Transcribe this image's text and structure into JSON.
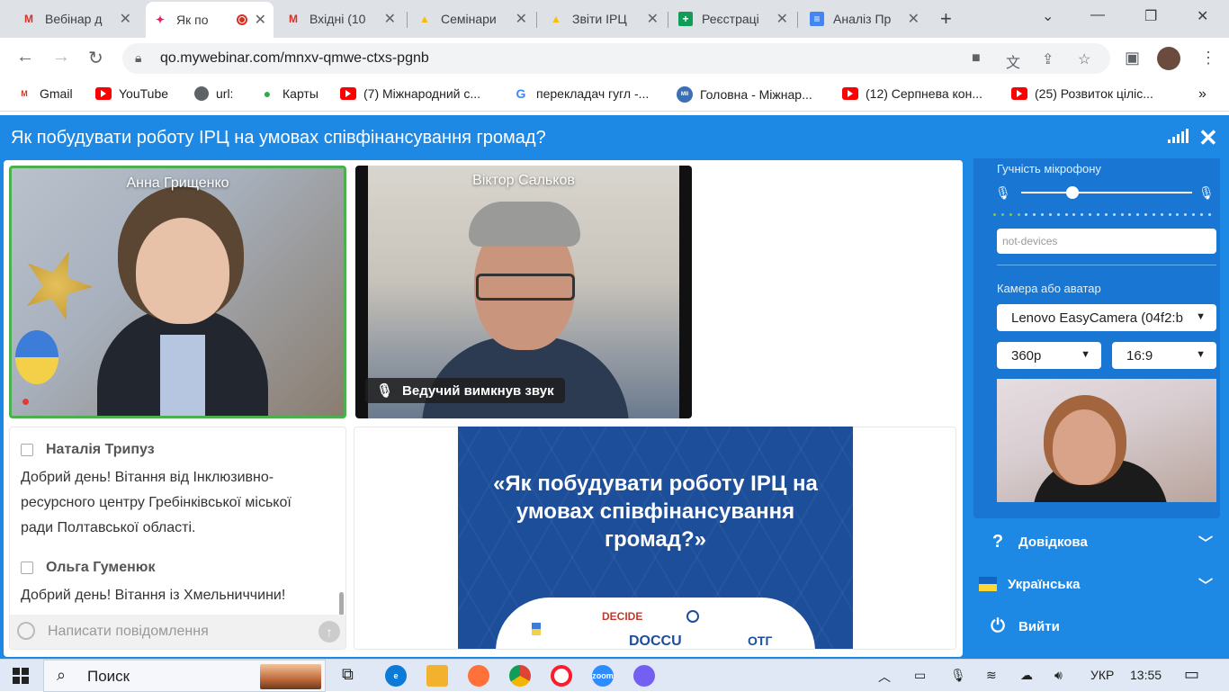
{
  "browser": {
    "tabs": [
      {
        "label": "Вебінар д",
        "icon": "gmail-icon",
        "color": "#d93025"
      },
      {
        "label": "Як по",
        "icon": "mywebinar-icon",
        "color": "#e91e63",
        "recording": true
      },
      {
        "label": "Вхідні (10",
        "icon": "gmail-icon",
        "color": "#d93025"
      },
      {
        "label": "Семінари",
        "icon": "drive-icon",
        "color": "#fbbc04"
      },
      {
        "label": "Звіти ІРЦ",
        "icon": "drive-icon",
        "color": "#fbbc04"
      },
      {
        "label": "Реєстраці",
        "icon": "sheets-plus-icon",
        "color": "#0f9d58"
      },
      {
        "label": "Аналіз Пр",
        "icon": "docs-icon",
        "color": "#4285f4"
      }
    ],
    "url": "qo.mywebinar.com/mnxv-qmwe-ctxs-pgnb",
    "bookmarks": [
      {
        "label": "Gmail",
        "icon": "gmail-icon"
      },
      {
        "label": "YouTube",
        "icon": "youtube-icon"
      },
      {
        "label": "url:",
        "icon": "globe-icon"
      },
      {
        "label": "Карты",
        "icon": "maps-pin-icon"
      },
      {
        "label": "(7) Міжнародний с...",
        "icon": "youtube-icon"
      },
      {
        "label": "перекладач гугл -...",
        "icon": "google-icon"
      },
      {
        "label": "Головна - Міжнар...",
        "icon": "mii-icon"
      },
      {
        "label": "(12) Серпнева кон...",
        "icon": "youtube-icon"
      },
      {
        "label": "(25) Розвиток ціліс...",
        "icon": "youtube-icon"
      }
    ]
  },
  "webinar": {
    "title": "Як побудувати роботу ІРЦ на умовах співфінансування громад?",
    "videos": [
      {
        "name": "Анна Грищенко"
      },
      {
        "name": "Віктор Сальков",
        "muted_label": "Ведучий вимкнув звук"
      }
    ],
    "chat": {
      "messages": [
        {
          "author": "Наталія Трипуз",
          "text": "Добрий день! Вітання від Інклюзивно-ресурсного центру Гребінківської міської ради Полтавської області."
        },
        {
          "author": "Ольга Гуменюк",
          "text": "Добрий день! Вітання із Хмельниччини!"
        }
      ],
      "placeholder": "Написати повідомлення"
    },
    "slide": {
      "title": "«Як побудувати роботу ІРЦ на умовах співфінансування громад?»",
      "logos": [
        "DECIDE",
        "DOCCU",
        "ОТГ"
      ]
    }
  },
  "settings": {
    "mic_volume_label": "Гучність мікрофону",
    "mic_volume": 0.3,
    "mic_device_placeholder": "not-devices",
    "camera_label": "Камера або аватар",
    "camera_device": "Lenovo EasyCamera (04f2:b",
    "resolution": "360p",
    "aspect": "16:9"
  },
  "menu": {
    "help": "Довідкова",
    "language": "Українська",
    "logout": "Вийти"
  },
  "taskbar": {
    "search_label": "Поиск",
    "language": "УКР",
    "time": "13:55"
  }
}
